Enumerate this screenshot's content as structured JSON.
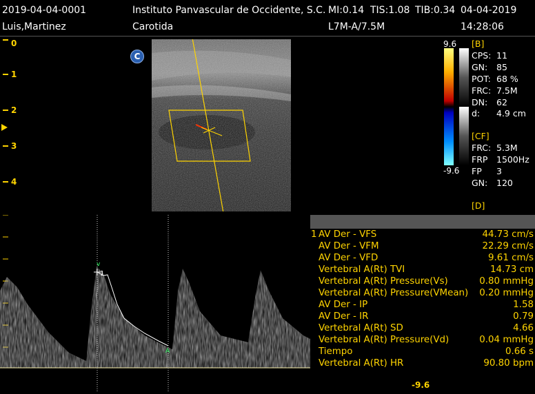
{
  "header": {
    "patient_id": "2019-04-04-0001",
    "institution": "Instituto Panvascular de Occidente, S.C.",
    "mi": "MI:0.14",
    "tis": "TIS:1.08",
    "tib": "TIB:0.34",
    "date": "04-04-2019",
    "patient_name": "Luis,Martinez",
    "exam": "Carotida",
    "probe": "L7M-A/7.5M",
    "time": "14:28:06"
  },
  "depth_scale": [
    "0",
    "1",
    "2",
    "3",
    "4"
  ],
  "badge": "C",
  "color_scale": {
    "top": "9.6",
    "bottom": "-9.6"
  },
  "params": {
    "b_head": "[B]",
    "b": [
      {
        "k": "CPS:",
        "v": "11"
      },
      {
        "k": "GN:",
        "v": "85"
      },
      {
        "k": "POT:",
        "v": "68 %"
      },
      {
        "k": "FRC:",
        "v": "7.5M"
      },
      {
        "k": "DN:",
        "v": "62"
      },
      {
        "k": "d:",
        "v": "4.9 cm"
      }
    ],
    "cf_head": "[CF]",
    "cf": [
      {
        "k": "FRC:",
        "v": "5.3M"
      },
      {
        "k": "FRP",
        "v": "1500Hz"
      },
      {
        "k": "FP",
        "v": "3"
      },
      {
        "k": "GN:",
        "v": "120"
      }
    ],
    "d_head": "[D]"
  },
  "measurements": [
    {
      "idx": "1",
      "label": "AV Der - VFS",
      "value": "44.73 cm/s"
    },
    {
      "idx": "",
      "label": "AV Der - VFM",
      "value": "22.29 cm/s"
    },
    {
      "idx": "",
      "label": "AV Der - VFD",
      "value": "9.61 cm/s"
    },
    {
      "idx": "",
      "label": "Vertebral A(Rt) TVI",
      "value": "14.73 cm"
    },
    {
      "idx": "",
      "label": "Vertebral A(Rt) Pressure(Vs)",
      "value": "0.80 mmHg"
    },
    {
      "idx": "",
      "label": "Vertebral A(Rt) Pressure(VMean)",
      "value": "0.20 mmHg"
    },
    {
      "idx": "",
      "label": "AV Der - IP",
      "value": "1.58"
    },
    {
      "idx": "",
      "label": "AV Der - IR",
      "value": "0.79"
    },
    {
      "idx": "",
      "label": "Vertebral A(Rt) SD",
      "value": "4.66"
    },
    {
      "idx": "",
      "label": "Vertebral A(Rt) Pressure(Vd)",
      "value": "0.04 mmHg"
    },
    {
      "idx": "",
      "label": "Tiempo",
      "value": "0.66 s"
    },
    {
      "idx": "",
      "label": "Vertebral A(Rt) HR",
      "value": "90.80 bpm"
    }
  ],
  "doppler_scale_bottom": "-9.6",
  "colors": {
    "accent": "#ffd400",
    "panel_gray": "#555555"
  }
}
